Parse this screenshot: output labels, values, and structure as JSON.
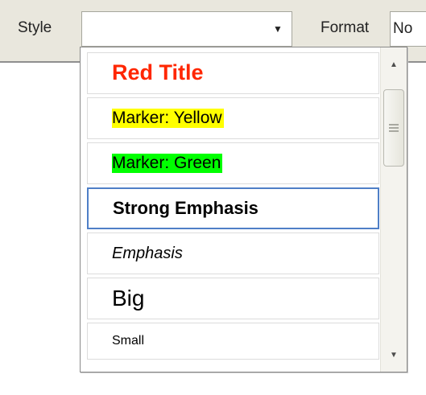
{
  "toolbar": {
    "style_label": "Style",
    "style_value": "",
    "format_label": "Format",
    "format_value": "No",
    "dropdown_arrow": "▼"
  },
  "style_dropdown": {
    "items": [
      {
        "label": "Red Title",
        "style": "red-title",
        "color": "#ff2600"
      },
      {
        "label": "Marker: Yellow",
        "style": "marker-yellow",
        "color": "#ffff00"
      },
      {
        "label": "Marker: Green",
        "style": "marker-green",
        "color": "#00ff00"
      },
      {
        "label": "Strong Emphasis",
        "style": "strong",
        "selected": true
      },
      {
        "label": "Emphasis",
        "style": "emphasis"
      },
      {
        "label": "Big",
        "style": "big"
      },
      {
        "label": "Small",
        "style": "small"
      }
    ],
    "selected_border_color": "#4f7fc7"
  },
  "scrollbar": {
    "up_icon": "▲",
    "down_icon": "▼"
  }
}
